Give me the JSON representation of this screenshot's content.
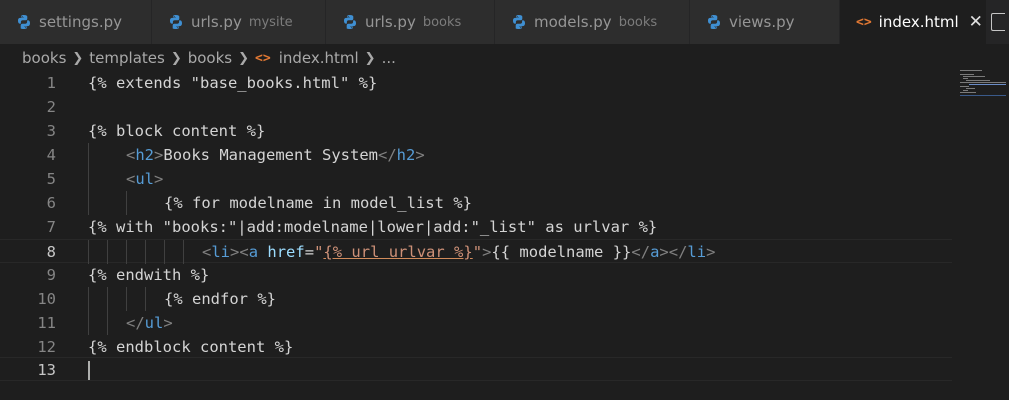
{
  "tabs": [
    {
      "label": "settings.py",
      "description": "",
      "icon": "python-icon"
    },
    {
      "label": "urls.py",
      "description": "mysite",
      "icon": "python-icon"
    },
    {
      "label": "urls.py",
      "description": "books",
      "icon": "python-icon"
    },
    {
      "label": "models.py",
      "description": "books",
      "icon": "python-icon"
    },
    {
      "label": "views.py",
      "description": "",
      "icon": "python-icon"
    },
    {
      "label": "index.html",
      "description": "",
      "icon": "html-icon",
      "active": true,
      "close": "✕"
    }
  ],
  "breadcrumb": {
    "items": [
      "books",
      "templates",
      "books",
      "index.html",
      "..."
    ],
    "html_icon_glyph": "<>"
  },
  "editor": {
    "lines": [
      {
        "n": "1",
        "t1": "{% extends \"base_books.html\" %}"
      },
      {
        "n": "2"
      },
      {
        "n": "3",
        "t1": "{% block content %}"
      },
      {
        "n": "4",
        "o1": "<",
        "tg1": "h2",
        "c1": ">",
        "t1": "Books Management System",
        "o2": "</",
        "tg2": "h2",
        "c2": ">"
      },
      {
        "n": "5",
        "o1": "<",
        "tg1": "ul",
        "c1": ">"
      },
      {
        "n": "6",
        "t1": "{% for modelname in model_list %}"
      },
      {
        "n": "7",
        "t1": "{% with \"books:\"|add:modelname|lower|add:\"_list\" as urlvar %}"
      },
      {
        "n": "8",
        "o1": "<",
        "tg1": "li",
        "c1": ">",
        "o2": "<",
        "tg2": "a",
        "attr": "href",
        "eq": "=",
        "q1": "\"",
        "url": "{% url urlvar %}",
        "q2": "\"",
        "c2": ">",
        "t1": "{{ modelname }}",
        "o3": "</",
        "tg3": "a",
        "c3": ">",
        "o4": "</",
        "tg4": "li",
        "c4": ">"
      },
      {
        "n": "9",
        "t1": "{% endwith %}"
      },
      {
        "n": "10",
        "t1": "{% endfor %}"
      },
      {
        "n": "11",
        "o1": "</",
        "tg1": "ul",
        "c1": ">"
      },
      {
        "n": "12",
        "t1": "{% endblock content %}"
      },
      {
        "n": "13"
      }
    ]
  },
  "colors": {
    "editor_bg": "#1e1e1e",
    "tag": "#569cd6",
    "attribute": "#9cdcfe",
    "string": "#ce9178",
    "html_icon": "#e37933",
    "python_icon": "#3f8fd2"
  }
}
